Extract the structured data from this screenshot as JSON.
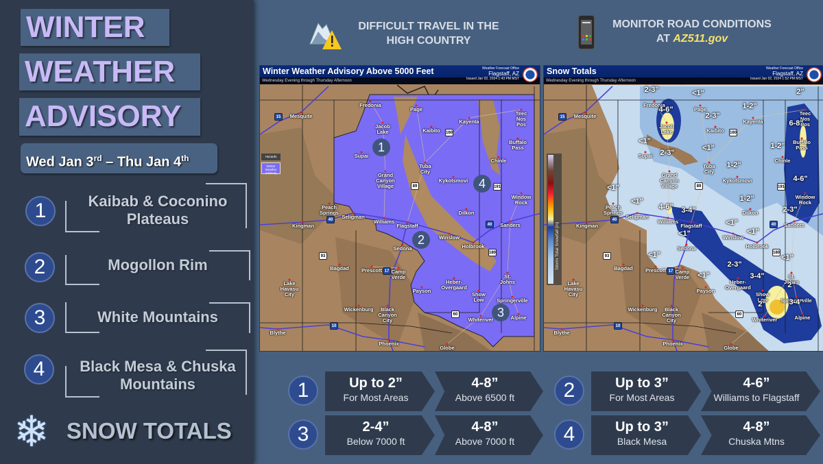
{
  "title": {
    "line1": "WINTER",
    "line2": "WEATHER",
    "line3": "ADVISORY"
  },
  "date": {
    "start": "Wed Jan 3",
    "start_sup": "rd",
    "sep": " – ",
    "end": "Thu Jan 4",
    "end_sup": "th"
  },
  "regions": [
    {
      "num": "1",
      "name": "Kaibab & Coconino Plateaus"
    },
    {
      "num": "2",
      "name": "Mogollon Rim"
    },
    {
      "num": "3",
      "name": "White Mountains"
    },
    {
      "num": "4",
      "name": "Black Mesa & Chuska Mountains"
    }
  ],
  "snow_totals_label": "SNOW TOTALS",
  "header": {
    "travel": {
      "line1": "DIFFICULT TRAVEL IN THE",
      "line2": "HIGH COUNTRY",
      "icon": "mountain-warning-icon"
    },
    "road": {
      "line1": "MONITOR ROAD CONDITIONS",
      "line2_prefix": "AT ",
      "link": "AZ511.gov",
      "icon": "smartphone-icon"
    }
  },
  "colors": {
    "advisory": "#7b6cf5",
    "accent_title": "#c9b9f6",
    "link": "#f5e26a"
  },
  "maps": [
    {
      "title": "Winter Weather Advisory Above 5000 Feet",
      "subtitle": "Wednesday Evening through Thursday Afternoon",
      "office_label": "Weather Forecast Office",
      "office": "Flagstaff, AZ",
      "issued": "Issued Jan 02, 2024 1:43 PM MST",
      "legend_title": "Hazards",
      "legend_item": "Winter Weather Advisory",
      "zones": [
        "1",
        "2",
        "3",
        "4"
      ]
    },
    {
      "title": "Snow Totals",
      "subtitle": "Wednesday Evening through Thursday Afternoon",
      "office_label": "Weather Forecast Office",
      "office": "Flagstaff, AZ",
      "issued": "Issued Jan 02, 2024 1:52 PM MST",
      "legend_axis": "Storm Total Snowfall (in)",
      "amounts": [
        "2-3\"",
        "<1\"",
        "2\"",
        "4-6\"",
        "1-2\"",
        "2-3\"",
        "6-8\"",
        "<1\"",
        "1-2\"",
        "2-3\"",
        "<1\"",
        "1-2\"",
        "4-6\"",
        "<1\"",
        "1-2\"",
        "<1\"",
        "4-6\"",
        "3-4\"",
        "2-3\"",
        "<1\"",
        "<1\"",
        "<1\"",
        "<1\"",
        "<1\"",
        "2-3\"",
        "<1\"",
        "3-4\"",
        "2\"",
        "3-4\"",
        "2\""
      ]
    }
  ],
  "cities": [
    "Fredonia",
    "Page",
    "Jacob\nLake",
    "Kaibito",
    "Kayenta",
    "Teec\nNos\nPos",
    "Buffalo\nPass",
    "Supai",
    "Grand\nCanyon\nVillage",
    "Tuba\nCity",
    "Chinle",
    "Kykotsmovi",
    "Window\nRock",
    "Mesquite",
    "Peach\nSprings",
    "Seligman",
    "Williams",
    "Dilkon",
    "Kingman",
    "Flagstaff",
    "Sanders",
    "Winslow",
    "Holbrook",
    "Sedona",
    "Bagdad",
    "Prescott",
    "Camp\nVerde",
    "Heber-\nOvergaard",
    "St.\nJohns",
    "Lake\nHavasu\nCity",
    "Payson",
    "Show\nLow",
    "Springerville",
    "Black\nCanyon\nCity",
    "Wickenburg",
    "Whiteriver",
    "Alpine",
    "Blythe",
    "Phoenix",
    "Globe"
  ],
  "highways": [
    "15",
    "40",
    "40",
    "89",
    "160",
    "191",
    "93",
    "17",
    "60",
    "10",
    "180"
  ],
  "forecast": [
    {
      "zone": "1",
      "a_big": "Up to 2”",
      "a_small": "For Most Areas",
      "b_big": "4-8”",
      "b_small": "Above 6500 ft"
    },
    {
      "zone": "2",
      "a_big": "Up to 3”",
      "a_small": "For Most Areas",
      "b_big": "4-6”",
      "b_small": "Williams to Flagstaff"
    },
    {
      "zone": "3",
      "a_big": "2-4”",
      "a_small": "Below 7000 ft",
      "b_big": "4-8”",
      "b_small": "Above 7000 ft"
    },
    {
      "zone": "4",
      "a_big": "Up to 3”",
      "a_small": "Black Mesa",
      "b_big": "4-8”",
      "b_small": "Chuska Mtns"
    }
  ]
}
